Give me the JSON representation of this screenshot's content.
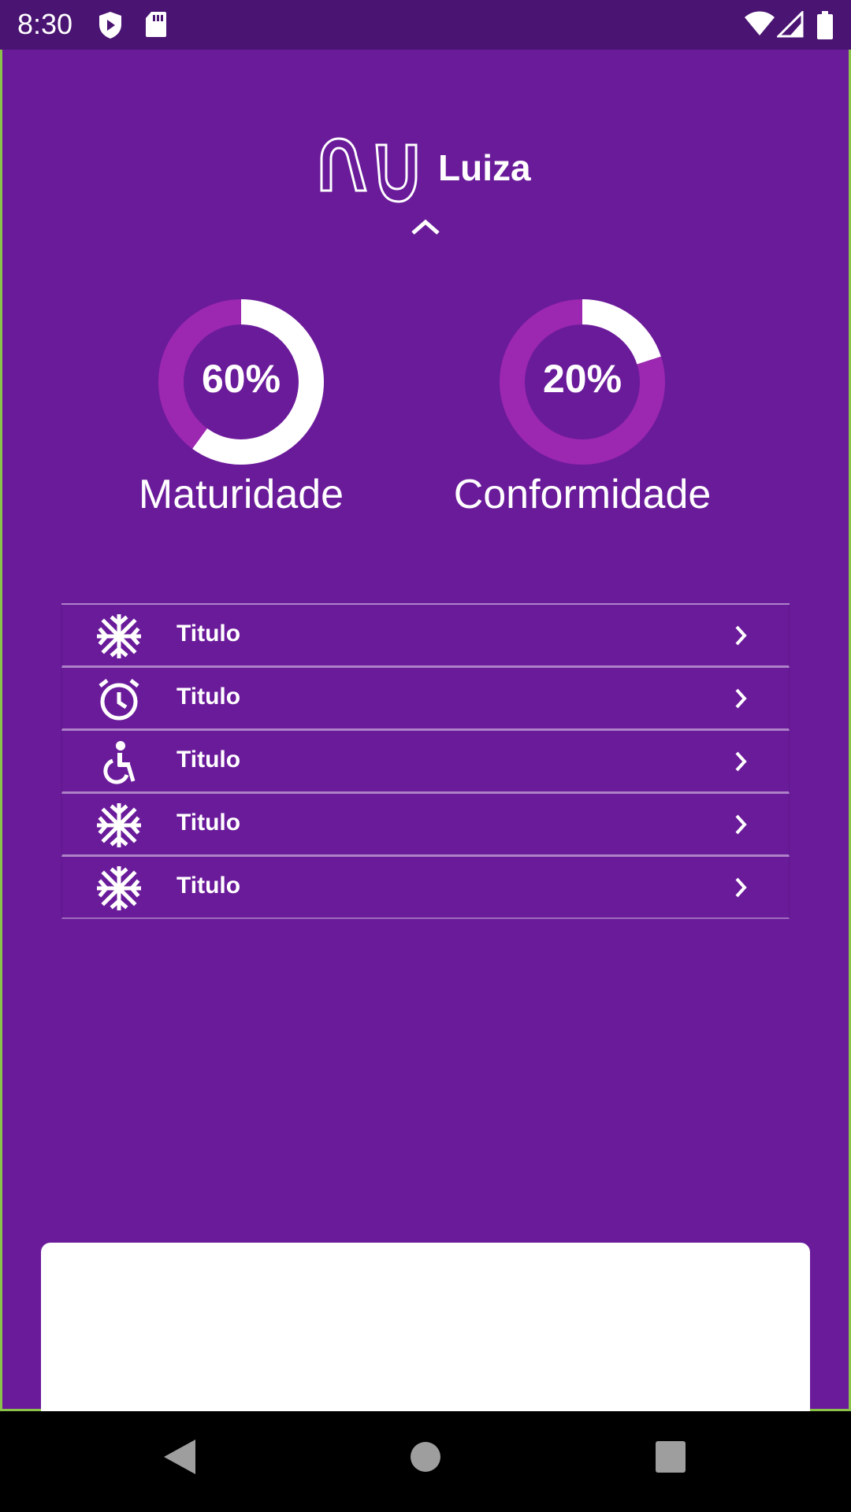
{
  "status_bar": {
    "time": "8:30",
    "left_icons": [
      "shield-icon",
      "sd-card-icon"
    ],
    "right_icons": [
      "wifi-icon",
      "signal-icon",
      "battery-icon"
    ]
  },
  "header": {
    "logo": "nu",
    "user_name": "Luiza",
    "toggle_icon": "chevron-up-icon"
  },
  "colors": {
    "background": "#6a1b9a",
    "status_bar": "#4a1472",
    "ring_track": "#9c27b0",
    "ring_fill": "#ffffff"
  },
  "gauges": [
    {
      "value": 60,
      "display": "60%",
      "label": "Maturidade"
    },
    {
      "value": 20,
      "display": "20%",
      "label": "Conformidade"
    }
  ],
  "menu": [
    {
      "icon": "snowflake-icon",
      "label": "Titulo"
    },
    {
      "icon": "alarm-clock-icon",
      "label": "Titulo"
    },
    {
      "icon": "accessibility-icon",
      "label": "Titulo"
    },
    {
      "icon": "snowflake-icon",
      "label": "Titulo"
    },
    {
      "icon": "snowflake-icon",
      "label": "Titulo"
    }
  ],
  "nav_bar": {
    "buttons": [
      "back-icon",
      "home-icon",
      "recents-icon"
    ]
  }
}
